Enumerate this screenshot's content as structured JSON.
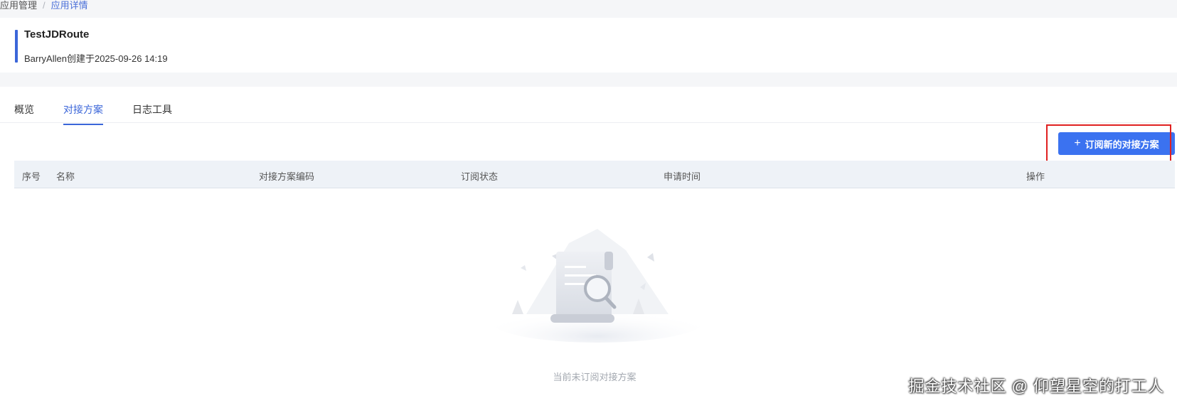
{
  "breadcrumb": {
    "items": [
      {
        "label": "应用管理"
      },
      {
        "label": "应用详情"
      }
    ],
    "separator": "/"
  },
  "app": {
    "name": "TestJDRoute",
    "meta": "BarryAllen创建于2025-09-26 14:19"
  },
  "tabs": [
    {
      "label": "概览",
      "active": false
    },
    {
      "label": "对接方案",
      "active": true
    },
    {
      "label": "日志工具",
      "active": false
    }
  ],
  "toolbar": {
    "subscribe_label": "订阅新的对接方案",
    "subscribe_icon": "plus-icon"
  },
  "table": {
    "columns": [
      "序号",
      "名称",
      "对接方案编码",
      "订阅状态",
      "申请时间",
      "操作"
    ],
    "rows": []
  },
  "empty_state": {
    "icon": "empty-document-search-icon",
    "message": "当前未订阅对接方案"
  },
  "watermark": "掘金技术社区 @ 仰望星空的打工人",
  "colors": {
    "primary": "#3b72f0",
    "accent": "#3b66d9",
    "highlight": "#e02020"
  }
}
